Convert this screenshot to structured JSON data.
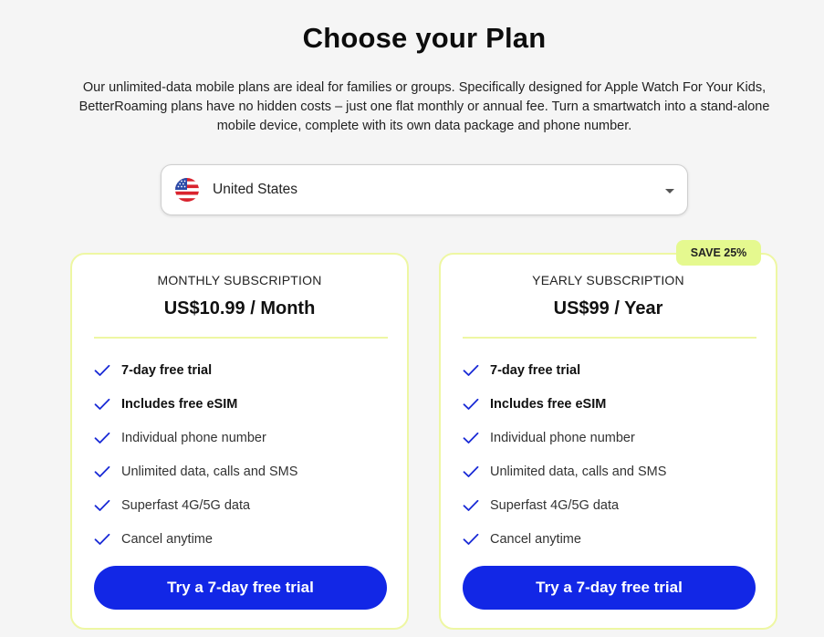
{
  "header": {
    "title": "Choose your Plan",
    "intro": "Our unlimited-data mobile plans are ideal for families or groups. Specifically designed for Apple Watch For Your Kids, BetterRoaming plans have no hidden costs – just one flat monthly or annual fee. Turn a smartwatch into a stand-alone mobile device, complete with its own data package and phone number."
  },
  "country_selector": {
    "selected": "United States",
    "flag_icon": "us-flag-icon",
    "caret_icon": "chevron-down-icon"
  },
  "colors": {
    "accent": "#1227e6",
    "card_border": "#eef7a3",
    "badge_bg": "#e5f98f",
    "check": "#1a2bd6"
  },
  "plans": [
    {
      "kicker": "MONTHLY SUBSCRIPTION",
      "price": "US$10.99 / Month",
      "features": [
        {
          "text": "7-day free trial",
          "bold": true
        },
        {
          "text": "Includes free eSIM",
          "bold": true
        },
        {
          "text": "Individual phone number",
          "bold": false
        },
        {
          "text": "Unlimited data, calls and SMS",
          "bold": false
        },
        {
          "text": "Superfast 4G/5G data",
          "bold": false
        },
        {
          "text": "Cancel anytime",
          "bold": false
        }
      ],
      "cta": "Try a 7-day free trial"
    },
    {
      "kicker": "YEARLY SUBSCRIPTION",
      "price": "US$99 / Year",
      "badge": "SAVE 25%",
      "features": [
        {
          "text": "7-day free trial",
          "bold": true
        },
        {
          "text": "Includes free eSIM",
          "bold": true
        },
        {
          "text": "Individual phone number",
          "bold": false
        },
        {
          "text": "Unlimited data, calls and SMS",
          "bold": false
        },
        {
          "text": "Superfast 4G/5G data",
          "bold": false
        },
        {
          "text": "Cancel anytime",
          "bold": false
        }
      ],
      "cta": "Try a 7-day free trial"
    }
  ]
}
